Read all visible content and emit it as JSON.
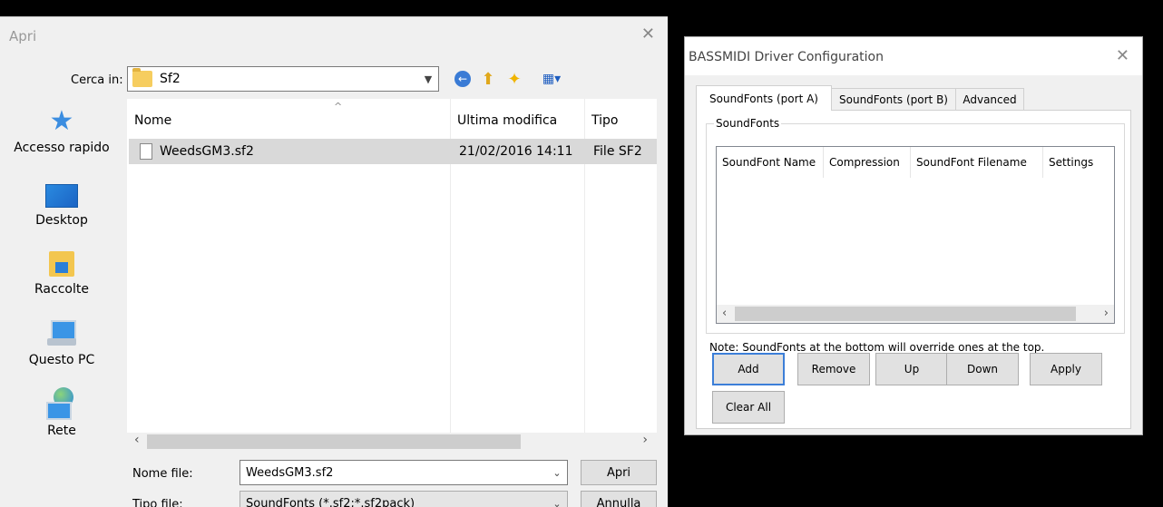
{
  "open_dialog": {
    "title": "Apri",
    "close_glyph": "✕",
    "look_in": {
      "label": "Cerca in:",
      "value": "Sf2"
    },
    "toolbar": {
      "back_icon": "back-arrow-icon",
      "up_icon": "up-folder-icon",
      "new_folder_icon": "new-folder-icon",
      "view_icon": "view-menu-icon"
    },
    "places": [
      {
        "label": "Accesso rapido",
        "icon": "quick-access-star-icon"
      },
      {
        "label": "Desktop",
        "icon": "desktop-icon"
      },
      {
        "label": "Raccolte",
        "icon": "libraries-icon"
      },
      {
        "label": "Questo PC",
        "icon": "this-pc-icon"
      },
      {
        "label": "Rete",
        "icon": "network-icon"
      }
    ],
    "columns": {
      "name": "Nome",
      "modified": "Ultima modifica",
      "type": "Tipo"
    },
    "files": [
      {
        "name": "WeedsGM3.sf2",
        "modified": "21/02/2016 14:11",
        "type": "File SF2"
      }
    ],
    "file_name": {
      "label": "Nome file:",
      "value": "WeedsGM3.sf2"
    },
    "file_type": {
      "label": "Tipo file:",
      "value": "SoundFonts (*.sf2;*.sf2pack)"
    },
    "buttons": {
      "open": "Apri",
      "cancel": "Annulla"
    }
  },
  "bassmidi": {
    "title": "BASSMIDI Driver Configuration",
    "close_glyph": "✕",
    "tabs": [
      "SoundFonts (port A)",
      "SoundFonts (port B)",
      "Advanced"
    ],
    "group_label": "SoundFonts",
    "columns": [
      "SoundFont Name",
      "Compression",
      "SoundFont Filename",
      "Settings"
    ],
    "note": "Note: SoundFonts at the bottom will override ones at the top.",
    "buttons": {
      "add": "Add",
      "remove": "Remove",
      "up": "Up",
      "down": "Down",
      "apply": "Apply",
      "clear_all": "Clear All"
    }
  }
}
